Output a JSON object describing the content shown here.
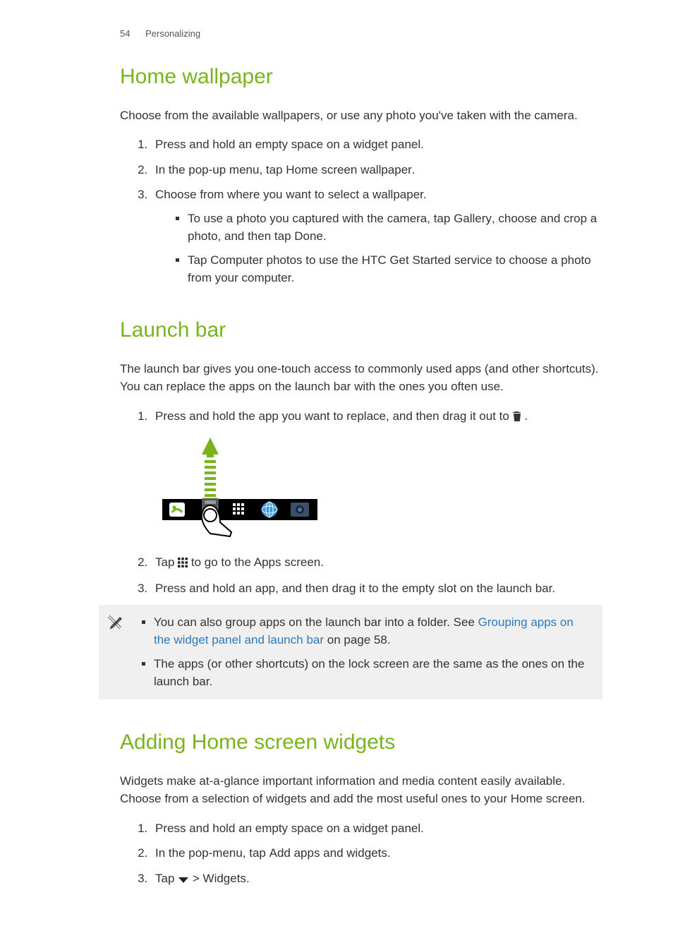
{
  "header": {
    "page": "54",
    "section": "Personalizing"
  },
  "s1": {
    "title": "Home wallpaper",
    "intro": "Choose from the available wallpapers, or use any photo you've taken with the camera.",
    "step1": "Press and hold an empty space on a widget panel.",
    "step2a": "In the pop-up menu, tap ",
    "step2b": "Home screen wallpaper",
    "step2c": ".",
    "step3": "Choose from where you want to select a wallpaper.",
    "sub1a": "To use a photo you captured with the camera, tap ",
    "sub1b": "Gallery",
    "sub1c": ", choose and crop a photo, and then tap ",
    "sub1d": "Done",
    "sub1e": ".",
    "sub2a": "Tap ",
    "sub2b": "Computer photos",
    "sub2c": " to use the HTC Get Started service to choose a photo from your computer."
  },
  "s2": {
    "title": "Launch bar",
    "intro": "The launch bar gives you one-touch access to commonly used apps (and other shortcuts). You can replace the apps on the launch bar with the ones you often use.",
    "step1a": "Press and hold the app you want to replace, and then drag it out to ",
    "step1b": " .",
    "step2a": "Tap ",
    "step2b": " to go to the Apps screen.",
    "step3": "Press and hold an app, and then drag it to the empty slot on the launch bar.",
    "note1a": "You can also group apps on the launch bar into a folder. See ",
    "note1link": "Grouping apps on the widget panel and launch bar",
    "note1b": " on page 58.",
    "note2": "The apps (or other shortcuts) on the lock screen are the same as the ones on the launch bar."
  },
  "s3": {
    "title": "Adding Home screen widgets",
    "intro": "Widgets make at-a-glance important information and media content easily available. Choose from a selection of widgets and add the most useful ones to your Home screen.",
    "step1": "Press and hold an empty space on a widget panel.",
    "step2a": "In the pop-menu, tap ",
    "step2b": "Add apps and widgets",
    "step2c": ".",
    "step3a": "Tap ",
    "step3b": " > ",
    "step3c": "Widgets",
    "step3d": "."
  }
}
